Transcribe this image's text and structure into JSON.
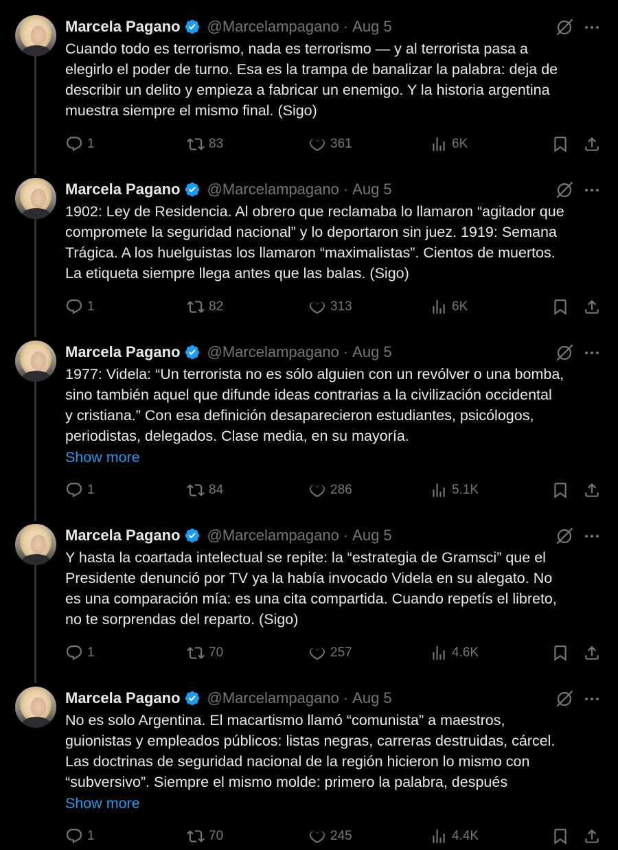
{
  "thread": {
    "author": {
      "name": "Marcela Pagano",
      "handle": "@Marcelampagano",
      "verified_color": "#1d9bf0"
    },
    "show_more_label": "Show more",
    "tweets": [
      {
        "date": "Aug 5",
        "lines": [
          "Cuando todo es terrorismo, nada es terrorismo — y al terrorista pasa a",
          "elegirlo el poder de turno. Esa es la trampa de banalizar la palabra: deja de",
          "describir un delito y empieza a fabricar un enemigo. Y la historia argentina",
          "muestra siempre el mismo final. (Sigo)"
        ],
        "replies": "1",
        "reposts": "83",
        "likes": "361",
        "views": "6K"
      },
      {
        "date": "Aug 5",
        "lines": [
          "1902: Ley de Residencia. Al obrero que reclamaba lo llamaron “agitador que",
          "compromete la seguridad nacional” y lo deportaron sin juez. 1919: Semana",
          "Trágica. A los huelguistas los llamaron “maximalistas”. Cientos de muertos.",
          "La etiqueta siempre llega antes que las balas. (Sigo)"
        ],
        "replies": "1",
        "reposts": "82",
        "likes": "313",
        "views": "6K"
      },
      {
        "date": "Aug 5",
        "lines": [
          "1977: Videla: “Un terrorista no es sólo alguien con un revólver o una bomba,",
          "sino también aquel que difunde ideas contrarias a la civilización occidental",
          "y cristiana.” Con esa definición desaparecieron estudiantes, psicólogos,",
          "periodistas, delegados. Clase media, en su mayoría."
        ],
        "replies": "1",
        "reposts": "84",
        "likes": "286",
        "views": "5.1K"
      },
      {
        "date": "Aug 5",
        "lines": [
          "Y hasta la coartada intelectual se repite: la “estrategia de Gramsci” que el",
          "Presidente denunció por TV ya la había invocado Videla en su alegato. No",
          "es una comparación mía: es una cita compartida. Cuando repetís el libreto,",
          "no te sorprendas del reparto. (Sigo)"
        ],
        "replies": "1",
        "reposts": "70",
        "likes": "257",
        "views": "4.6K"
      },
      {
        "date": "Aug 5",
        "lines": [
          "No es solo Argentina. El macartismo llamó “comunista” a maestros,",
          "guionistas y empleados públicos: listas negras, carreras destruidas, cárcel.",
          "Las doctrinas de seguridad nacional de la región hicieron lo mismo con",
          "“subversivo”. Siempre el mismo molde: primero la palabra, después"
        ],
        "replies": "1",
        "reposts": "70",
        "likes": "245",
        "views": "4.4K"
      }
    ]
  },
  "icons": {
    "reply": "reply-icon",
    "repost": "repost-icon",
    "like": "heart-icon",
    "views": "views-icon",
    "bookmark": "bookmark-icon",
    "share": "share-icon",
    "grok": "grok-icon",
    "more": "more-icon",
    "verified": "verified-badge-icon"
  },
  "colors": {
    "background": "#000000",
    "text": "#e7e9ea",
    "muted": "#71767b",
    "link": "#1d9bf0",
    "thread_line": "#333639"
  }
}
